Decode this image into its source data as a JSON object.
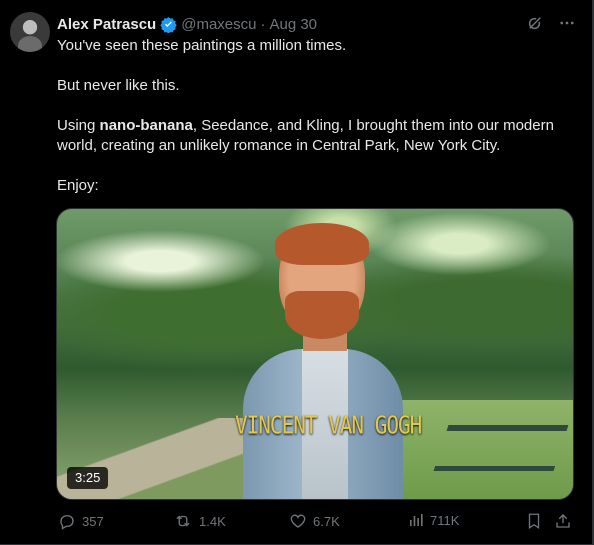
{
  "author": {
    "display_name": "Alex Patrascu",
    "handle": "@maxescu",
    "separator": "·",
    "time": "Aug 30",
    "verified_color": "#1d9bf0"
  },
  "tweet": {
    "line1": "You've seen these paintings a million times.",
    "line2": "But never like this.",
    "line3_prefix": "Using ",
    "line3_bold": "nano-banana",
    "line3_rest": ", Seedance, and Kling, I brought them into our modern world, creating an unlikely romance in Central Park, New York City.",
    "line4": "Enjoy:"
  },
  "media": {
    "caption": "VINCENT VAN GOGH",
    "duration": "3:25"
  },
  "stats": {
    "replies": "357",
    "reposts": "1.4K",
    "likes": "6.7K",
    "views": "711K"
  },
  "icons": {
    "grok": "grok-icon",
    "more": "more-icon",
    "reply": "reply-icon",
    "repost": "repost-icon",
    "like": "like-icon",
    "views": "views-icon",
    "bookmark": "bookmark-icon",
    "share": "share-icon"
  },
  "colors": {
    "background": "#000000",
    "text": "#e7e9ea",
    "muted": "#71767b",
    "caption": "#e5c84a"
  }
}
